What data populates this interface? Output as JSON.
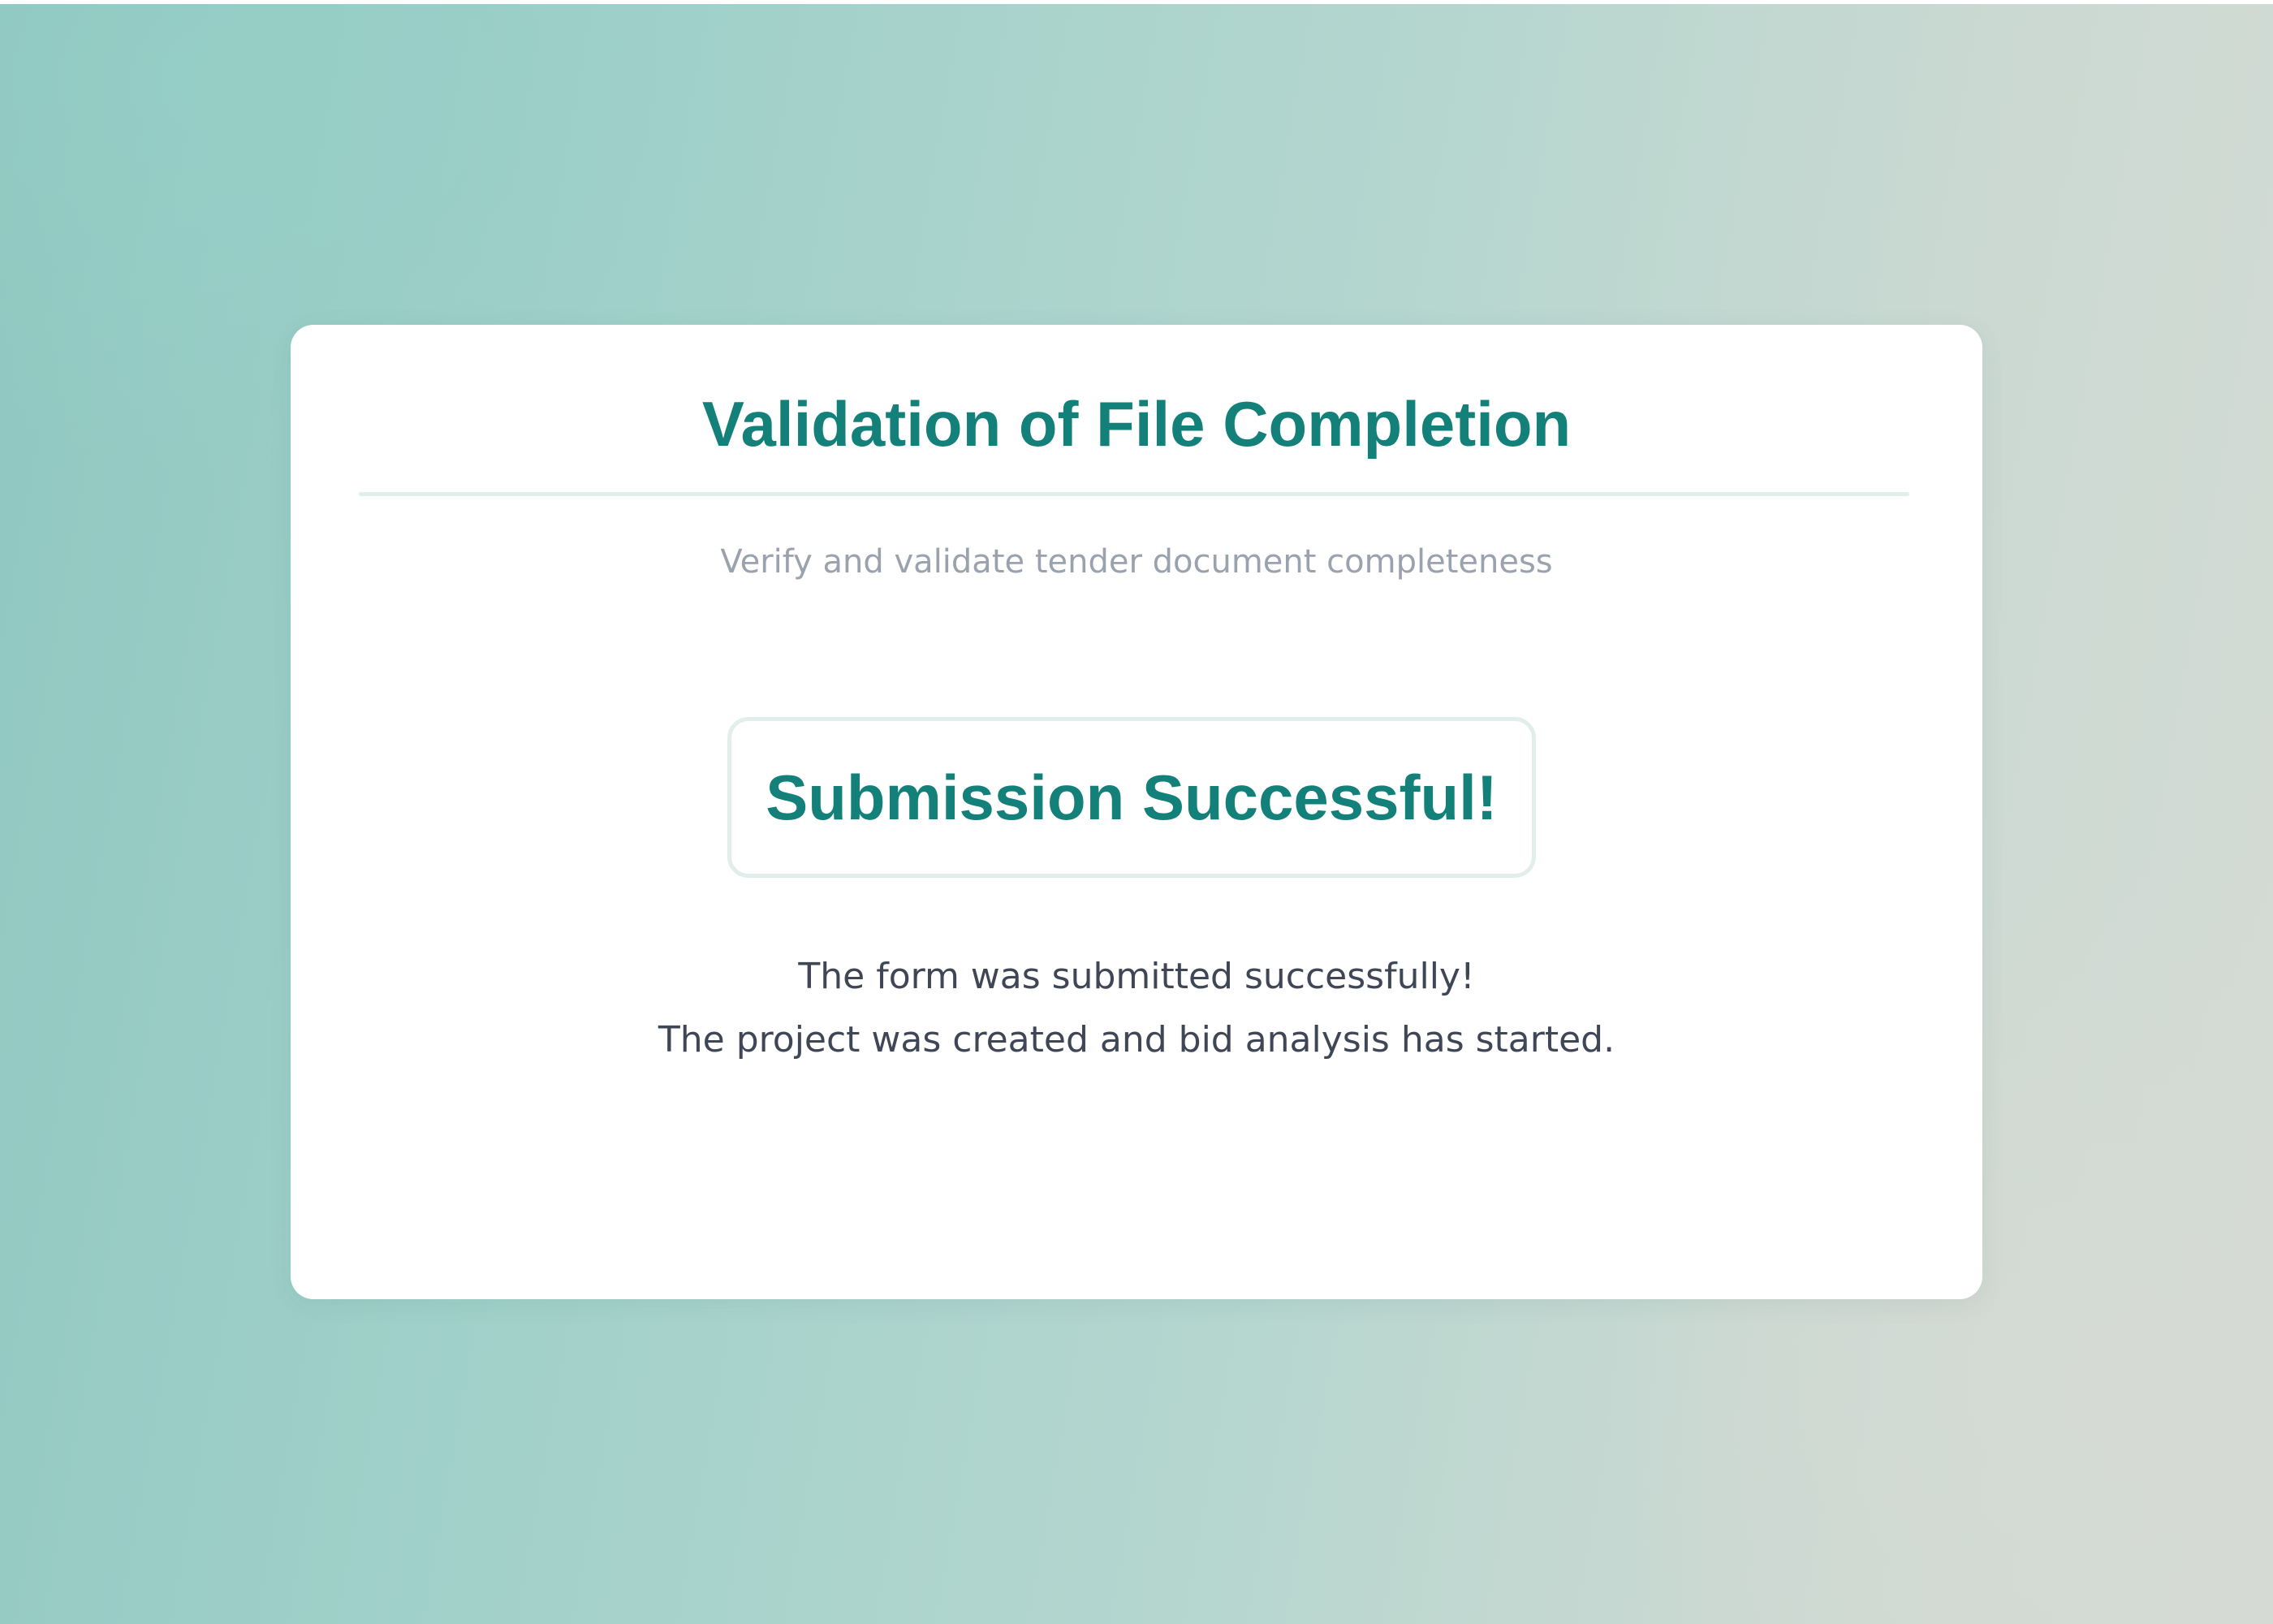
{
  "page": {
    "background": "#9fd0c9"
  },
  "card": {
    "title": "Validation of File Completion",
    "subtitle": "Verify and validate tender document completeness",
    "status_heading": "Submission Successful!",
    "message_lines": [
      "The form was submitted successfully!",
      "The project was created and bid analysis has started."
    ]
  },
  "colors": {
    "accent": "#14807a",
    "subtitle": "#9aa2ae",
    "body_text": "#3f4655",
    "divider": "#e1eeec"
  }
}
